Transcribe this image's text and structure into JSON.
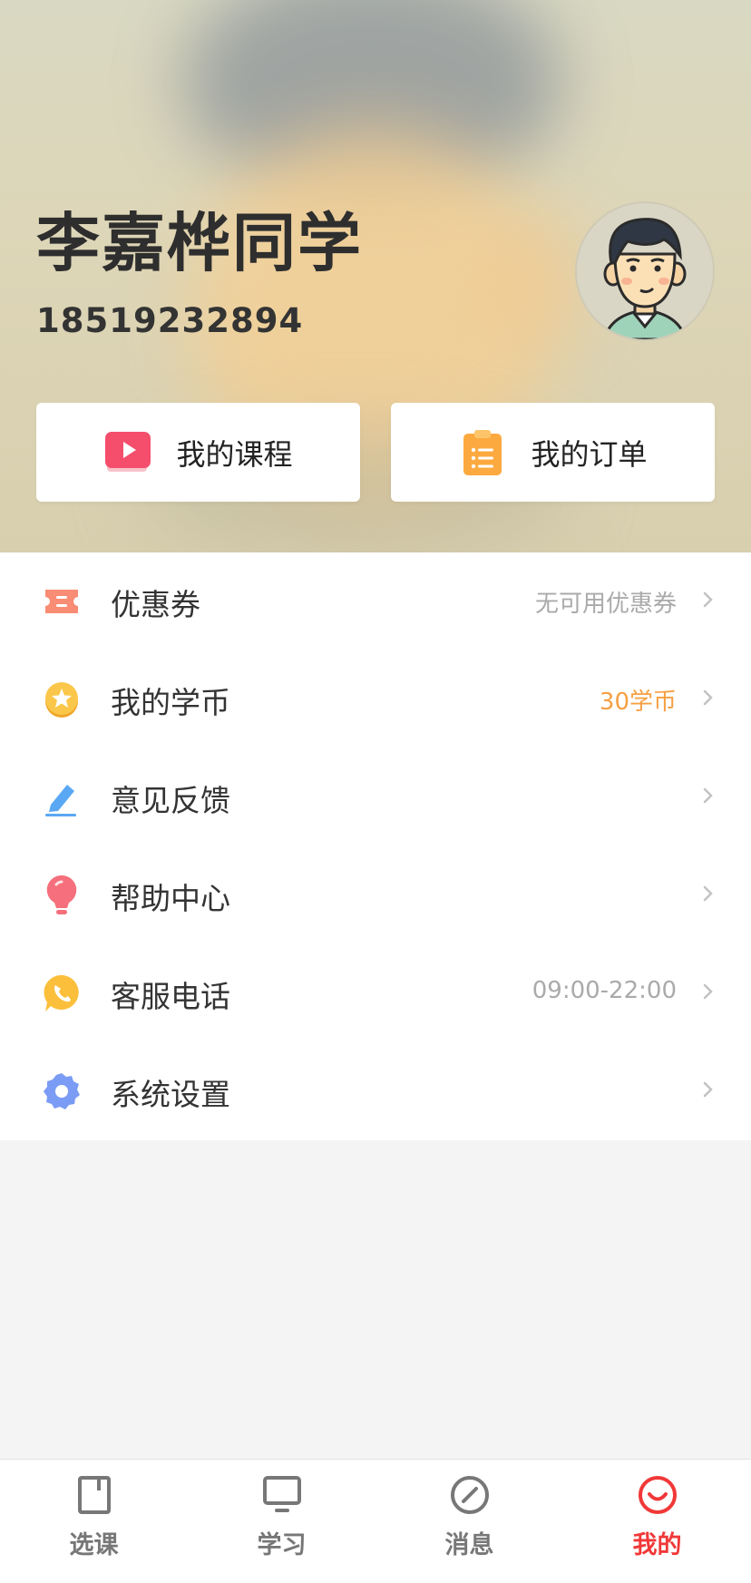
{
  "profile": {
    "name": "李嘉桦同学",
    "phone": "18519232894"
  },
  "quick_actions": {
    "courses_label": "我的课程",
    "orders_label": "我的订单"
  },
  "menu": {
    "items": [
      {
        "label": "优惠券",
        "value": "无可用优惠券",
        "icon": "ticket-icon"
      },
      {
        "label": "我的学币",
        "value": "30学币",
        "icon": "coin-star-icon"
      },
      {
        "label": "意见反馈",
        "value": "",
        "icon": "pencil-icon"
      },
      {
        "label": "帮助中心",
        "value": "",
        "icon": "lightbulb-icon"
      },
      {
        "label": "客服电话",
        "value": "09:00-22:00",
        "icon": "phone-icon"
      },
      {
        "label": "系统设置",
        "value": "",
        "icon": "gear-icon"
      }
    ]
  },
  "tabbar": {
    "tabs": [
      {
        "label": "选课",
        "icon": "book-icon"
      },
      {
        "label": "学习",
        "icon": "monitor-icon"
      },
      {
        "label": "消息",
        "icon": "compass-icon"
      },
      {
        "label": "我的",
        "icon": "smile-icon"
      }
    ],
    "active_index": 3
  },
  "colors": {
    "accent_red": "#f13838",
    "coin_orange": "#f6a043"
  }
}
